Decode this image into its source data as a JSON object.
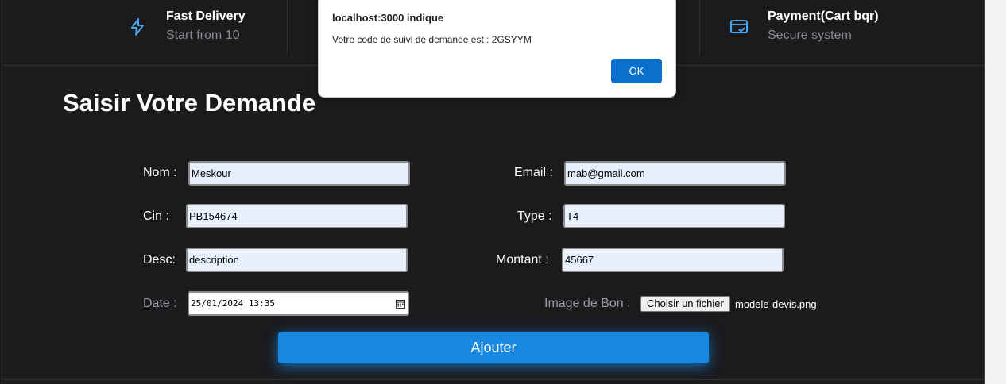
{
  "features": [
    {
      "title": "Fast Delivery",
      "subtitle": "Start from 10",
      "icon": "lightning-icon"
    },
    {
      "title": "Payment(Cart bqr)",
      "subtitle": "Secure system",
      "icon": "credit-card-icon"
    }
  ],
  "form": {
    "heading": "Saisir Votre Demande",
    "nom": {
      "label": "Nom :",
      "value": "Meskour"
    },
    "email": {
      "label": "Email :",
      "value": "mab@gmail.com"
    },
    "cin": {
      "label": "Cin :",
      "value": "PB154674"
    },
    "type": {
      "label": "Type :",
      "value": "T4"
    },
    "desc": {
      "label": "Desc:",
      "value": "description"
    },
    "montant": {
      "label": "Montant :",
      "value": "45667"
    },
    "date": {
      "label": "Date :",
      "value": "25/01/2024 13:35"
    },
    "image": {
      "label": "Image de Bon :",
      "button": "Choisir un fichier",
      "filename": "modele-devis.png"
    },
    "submit": "Ajouter"
  },
  "dialog": {
    "title": "localhost:3000 indique",
    "message": "Votre code de suivi de demande est : 2GSYYM",
    "ok": "OK"
  },
  "colors": {
    "background": "#1b1b1e",
    "accent": "#1787e0",
    "icon": "#4aa3f0",
    "input_bg": "#e8f0fe"
  }
}
